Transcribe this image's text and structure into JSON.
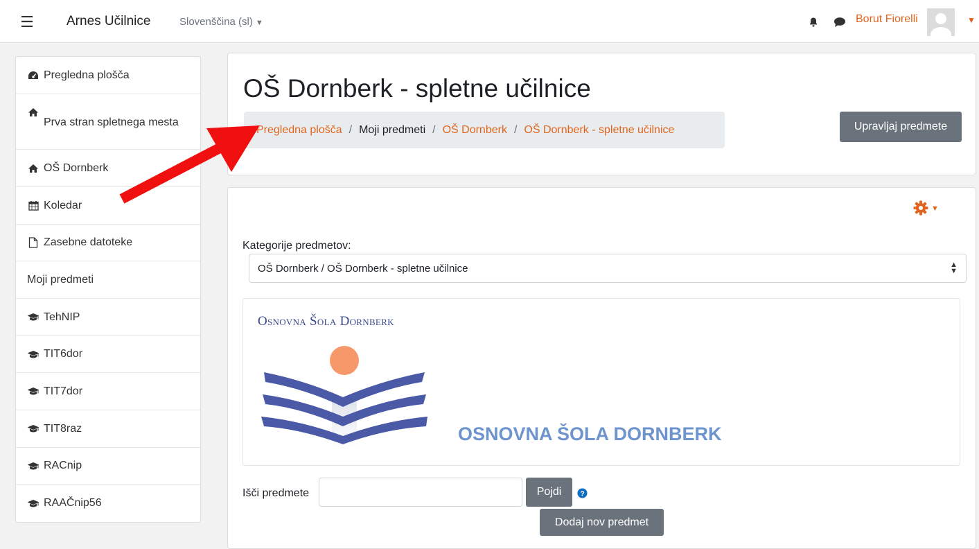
{
  "topbar": {
    "brand": "Arnes Učilnice",
    "language": "Slovenščina (sl)",
    "username": "Borut Fiorelli"
  },
  "sidebar": {
    "items": [
      {
        "label": "Pregledna plošča",
        "icon": "dashboard-icon"
      },
      {
        "label": "Prva stran spletnega mesta",
        "icon": "home-icon"
      },
      {
        "label": "OŠ Dornberk",
        "icon": "home-icon"
      },
      {
        "label": "Koledar",
        "icon": "calendar-icon"
      },
      {
        "label": "Zasebne datoteke",
        "icon": "file-icon"
      },
      {
        "label": "Moji predmeti",
        "icon": ""
      },
      {
        "label": "TehNIP",
        "icon": "graduation-cap-icon"
      },
      {
        "label": "TIT6dor",
        "icon": "graduation-cap-icon"
      },
      {
        "label": "TIT7dor",
        "icon": "graduation-cap-icon"
      },
      {
        "label": "TIT8raz",
        "icon": "graduation-cap-icon"
      },
      {
        "label": "RACnip",
        "icon": "graduation-cap-icon"
      },
      {
        "label": "RAAČnip56",
        "icon": "graduation-cap-icon"
      }
    ]
  },
  "header": {
    "title": "OŠ Dornberk - spletne učilnice",
    "breadcrumb": [
      "Pregledna plošča",
      "Moji predmeti",
      "OŠ Dornberk",
      "OŠ Dornberk - spletne učilnice"
    ],
    "manage_button": "Upravljaj predmete"
  },
  "content": {
    "category_label": "Kategorije predmetov:",
    "category_value": "OŠ Dornberk / OŠ Dornberk - spletne učilnice",
    "logo_small_text": "Osnovna Šola Dornberk",
    "logo_big_text": "OSNOVNA ŠOLA DORNBERK",
    "search_label": "Išči predmete",
    "search_value": "",
    "go_button": "Pojdi",
    "add_button": "Dodaj nov predmet"
  },
  "colors": {
    "accent": "#e1651e",
    "button": "#6a737b",
    "annotation_arrow": "#f01010"
  }
}
